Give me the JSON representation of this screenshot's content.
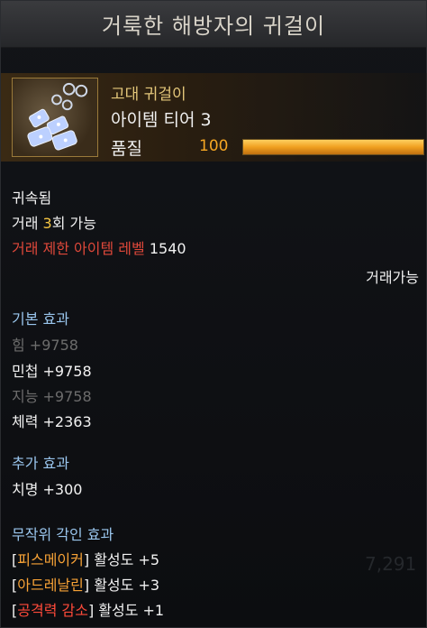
{
  "title": "거룩한 해방자의 귀걸이",
  "item": {
    "grade": "고대 귀걸이",
    "tier": "아이템 티어 3",
    "quality_label": "품질",
    "quality_value": "100",
    "quality_fraction": 1.0,
    "icon": "earring-icon"
  },
  "binding": "귀속됨",
  "trade": {
    "prefix": "거래 ",
    "count": "3",
    "suffix": "회 가능"
  },
  "level_limit": {
    "label": "거래 제한 아이템 레벨",
    "value": "1540"
  },
  "tradable": "거래가능",
  "basic": {
    "header": "기본 효과",
    "stats": [
      {
        "text": "힘 +9758",
        "active": false
      },
      {
        "text": "민첩 +9758",
        "active": true
      },
      {
        "text": "지능 +9758",
        "active": false
      },
      {
        "text": "체력 +2363",
        "active": true
      }
    ]
  },
  "additional": {
    "header": "추가 효과",
    "stats": [
      {
        "text": "치명 +300"
      }
    ]
  },
  "engraving": {
    "header": "무작위 각인 효과",
    "items": [
      {
        "open": "[",
        "name": "피스메이커",
        "close": "]",
        "rest": " 활성도 +5",
        "negative": false
      },
      {
        "open": "[",
        "name": "아드레날린",
        "close": "]",
        "rest": " 활성도 +3",
        "negative": false
      },
      {
        "open": "[",
        "name": "공격력 감소",
        "close": "]",
        "rest": " 활성도 +1",
        "negative": true
      }
    ]
  },
  "background_value": "7,291",
  "colors": {
    "gold": "#f5c542",
    "engrave_orange": "#f7a236",
    "negative_red": "#ff4a3a",
    "header_blue": "#9ac6ee"
  }
}
